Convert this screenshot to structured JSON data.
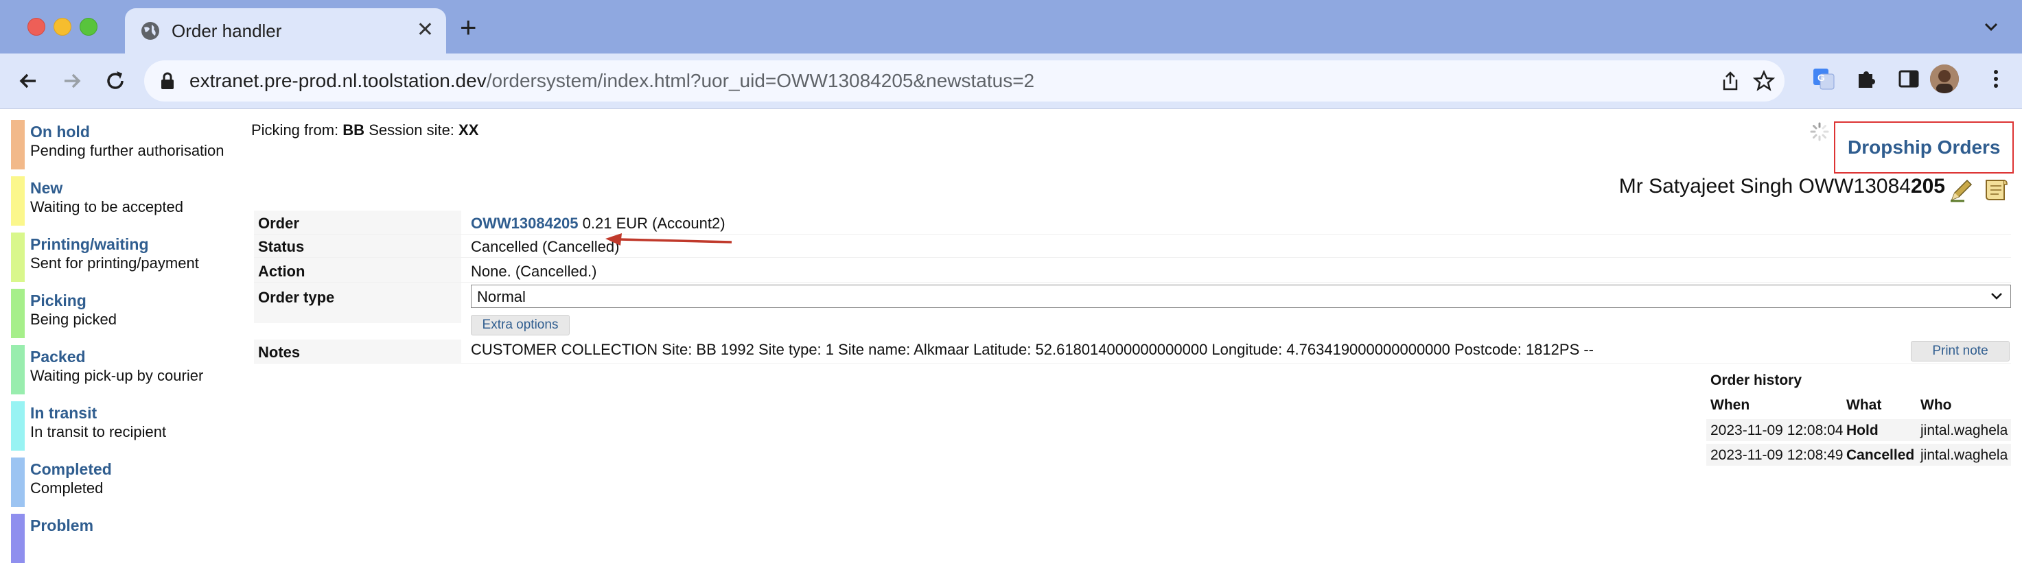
{
  "browser": {
    "tab_title": "Order handler",
    "url_host": "extranet.pre-prod.nl.toolstation.dev",
    "url_path": "/ordersystem/index.html?uor_uid=OWW13084205&newstatus=2"
  },
  "sidebar": {
    "items": [
      {
        "title": "On hold",
        "desc": "Pending further authorisation",
        "color": "#f2b98a"
      },
      {
        "title": "New",
        "desc": "Waiting to be accepted",
        "color": "#fbf78c"
      },
      {
        "title": "Printing/waiting",
        "desc": "Sent for printing/payment",
        "color": "#d9f78c"
      },
      {
        "title": "Picking",
        "desc": "Being picked",
        "color": "#a6ef8a"
      },
      {
        "title": "Packed",
        "desc": "Waiting pick-up by courier",
        "color": "#99edae"
      },
      {
        "title": "In transit",
        "desc": "In transit to recipient",
        "color": "#98f3f3"
      },
      {
        "title": "Completed",
        "desc": "Completed",
        "color": "#9cc4f2"
      },
      {
        "title": "Problem",
        "desc": "",
        "color": "#8f8fee"
      }
    ]
  },
  "header": {
    "picking_label": "Picking from:",
    "picking_site": "BB",
    "session_label": "Session site:",
    "session_site": "XX",
    "dropship_label": "Dropship Orders",
    "customer_prefix": "Mr Satyajeet Singh OWW13084",
    "customer_suffix": "205"
  },
  "order": {
    "order_label": "Order",
    "order_number": "OWW13084205",
    "order_amount": "0.21 EUR (Account2)",
    "status_label": "Status",
    "status_value": "Cancelled (Cancelled)",
    "action_label": "Action",
    "action_value": "None. (Cancelled.)",
    "type_label": "Order type",
    "type_value": "Normal",
    "extra_options": "Extra options",
    "notes_label": "Notes",
    "notes_value": "CUSTOMER COLLECTION Site: BB 1992 Site type: 1 Site name: Alkmaar Latitude: 52.618014000000000000 Longitude: 4.763419000000000000 Postcode: 1812PS --",
    "print_note": "Print note"
  },
  "history": {
    "title": "Order history",
    "col_when": "When",
    "col_what": "What",
    "col_who": "Who",
    "rows": [
      {
        "when": "2023-11-09 12:08:04",
        "what": "Hold",
        "who": "jintal.waghela"
      },
      {
        "when": "2023-11-09 12:08:49",
        "what": "Cancelled",
        "who": "jintal.waghela"
      }
    ]
  },
  "colors": {
    "link": "#2f5d8f",
    "annotation_arrow": "#c0392b",
    "highlight_box": "#dd3333"
  }
}
